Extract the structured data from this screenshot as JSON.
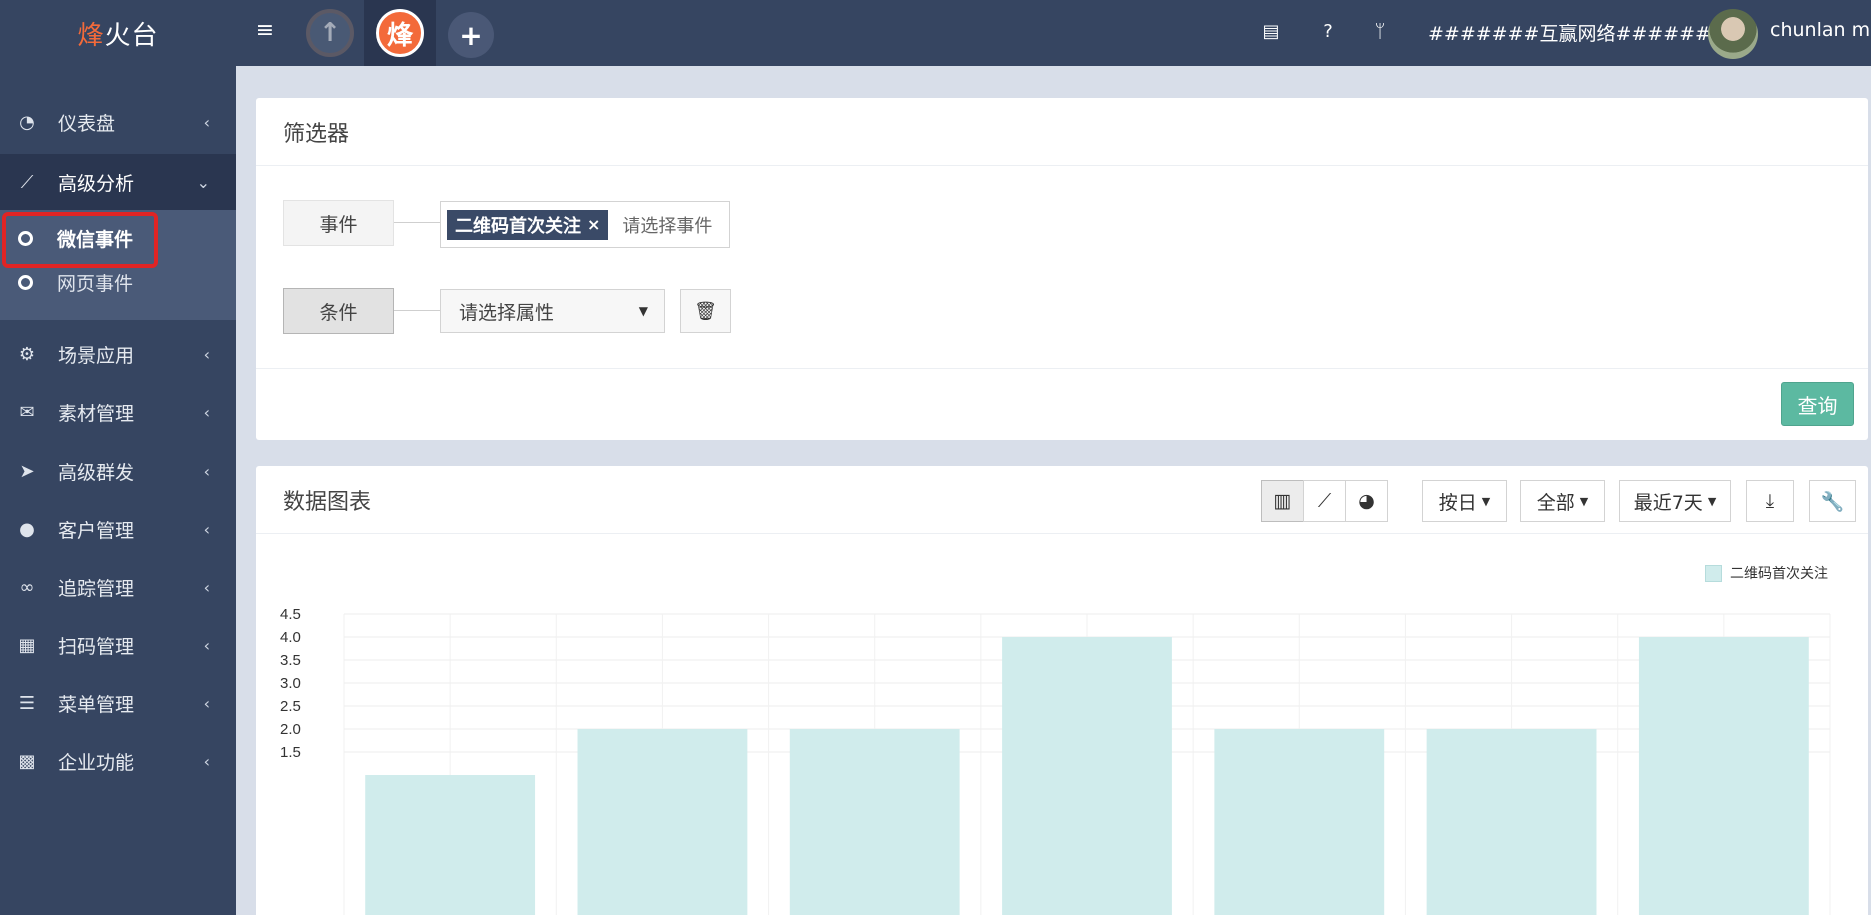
{
  "brand": {
    "accent": "烽",
    "rest": "火台"
  },
  "header": {
    "org_name": "#######互赢网络#######",
    "username": "chunlan ma",
    "app_active_glyph": "烽",
    "add_glyph": "+"
  },
  "sidebar": {
    "items": [
      {
        "label": "仪表盘",
        "icon": "dashboard-icon"
      },
      {
        "label": "高级分析",
        "icon": "line-chart-icon"
      },
      {
        "label": "场景应用",
        "icon": "gear-icon"
      },
      {
        "label": "素材管理",
        "icon": "envelope-icon"
      },
      {
        "label": "高级群发",
        "icon": "paper-plane-icon"
      },
      {
        "label": "客户管理",
        "icon": "user-icon"
      },
      {
        "label": "追踪管理",
        "icon": "link-icon"
      },
      {
        "label": "扫码管理",
        "icon": "qrcode-icon"
      },
      {
        "label": "菜单管理",
        "icon": "list-icon"
      },
      {
        "label": "企业功能",
        "icon": "grid-icon"
      }
    ],
    "submenu": [
      {
        "label": "微信事件"
      },
      {
        "label": "网页事件"
      }
    ]
  },
  "filter": {
    "title": "筛选器",
    "event_label": "事件",
    "selected_event": "二维码首次关注",
    "event_placeholder": "请选择事件",
    "condition_label": "条件",
    "attribute_placeholder": "请选择属性",
    "query_label": "查询"
  },
  "chart_panel": {
    "title": "数据图表",
    "group_by": "按日",
    "scope": "全部",
    "range": "最近7天"
  },
  "colors": {
    "sidebar_bg": "#364561",
    "accent": "#f36a3a",
    "query_button": "#5cb9a1",
    "bar_fill": "#d0ecec",
    "highlight": "#e02424"
  },
  "chart_data": {
    "type": "bar",
    "series": [
      {
        "name": "二维码首次关注",
        "values": [
          1,
          2,
          2,
          4,
          2,
          2,
          4
        ]
      }
    ],
    "y_ticks": [
      "1.5",
      "2.0",
      "2.5",
      "3.0",
      "3.5",
      "4.0",
      "4.5"
    ],
    "ylim_visible": [
      1.25,
      4.5
    ],
    "grid": true,
    "legend": "top-right"
  }
}
